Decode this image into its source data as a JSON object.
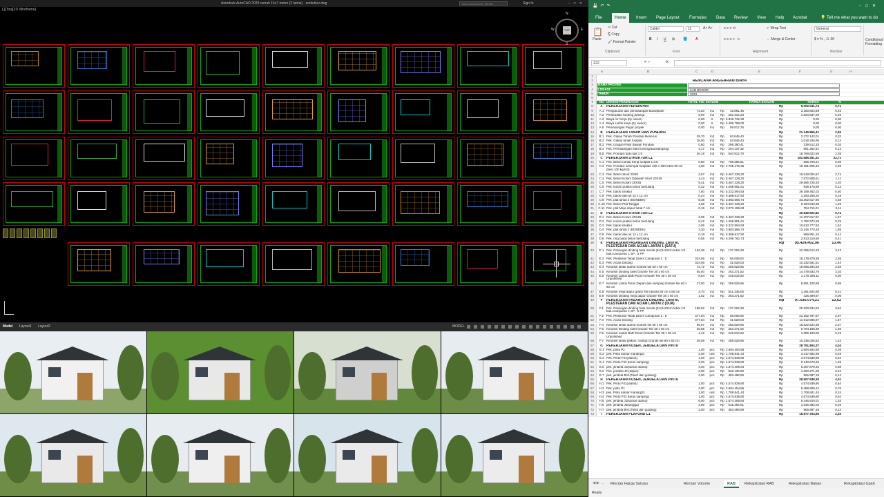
{
  "autocad": {
    "view_label": "[-][Top][2D Wireframe]",
    "app_title": "Autodesk AutoCAD 2020   rumah 15x7 meter (2 lantai) - arsitektur.dwg",
    "search_placeholder": "Type a keyword or phrase",
    "user_label": "Sign In",
    "viewcube": {
      "top": "TOP",
      "n": "N",
      "s": "S",
      "w": "W",
      "e": "E"
    },
    "layout_tabs": [
      "Model",
      "Layout1",
      "Layout2"
    ],
    "active_tab": "Model",
    "model_button": "MODEL",
    "colors": {
      "sheet_border": "#c00000",
      "sheet_frame": "#00b000",
      "background": "#000000"
    }
  },
  "excel": {
    "ribbon_tabs": [
      "File",
      "Home",
      "Insert",
      "Page Layout",
      "Formulas",
      "Data",
      "Review",
      "View",
      "Help",
      "Acrobat"
    ],
    "active_tab": "Home",
    "tell_me": "Tell me what you want to do",
    "clipboard": {
      "paste": "Paste",
      "cut": "Cut",
      "copy": "Copy",
      "format_painter": "Format Painter",
      "group": "Clipboard"
    },
    "font": {
      "name": "Calibri",
      "size": "11",
      "group": "Font"
    },
    "alignment": {
      "wrap_text": "Wrap Text",
      "merge_center": "Merge & Center",
      "group": "Alignment"
    },
    "number": {
      "format": "General",
      "group": "Number"
    },
    "conditional": "Conditional Formatting",
    "name_box": "Z22",
    "fx": "fx",
    "columns": [
      "A",
      "B",
      "C",
      "D",
      "E",
      "F",
      "G",
      "H"
    ],
    "sheet_title": "RENCANA ANGGARAN BIAYA",
    "info": [
      {
        "label": "NAMA PROYEK",
        "value": ""
      },
      {
        "label": "LOKASI",
        "value": "KAB BOGOR"
      },
      {
        "label": "TAHUN",
        "value": "2023"
      }
    ],
    "header": {
      "no": "NO",
      "uraian": "URAIAN PEKERJAAN",
      "vol": "TOTAL VOLUM",
      "sat": "SATUAN",
      "hs": "HARGA SATUAN",
      "hg": "HARGA",
      "pc": "%"
    },
    "rows": [
      {
        "n": "8",
        "no": "A",
        "u": "PEKERJAAN PERSIAPAN",
        "rp2": "Rp",
        "hg": "5.002.041,74",
        "pc": "0,71",
        "sec": true
      },
      {
        "n": "9",
        "no": "A.1",
        "u": "Pengukuran dan pemasangan Bouwplank",
        "v": "74,20",
        "s": "m1",
        "rp1": "Rp",
        "hs": "42.861,46",
        "rp2": "Rp",
        "hg": "3.180.804,89",
        "pc": "0,45"
      },
      {
        "n": "10",
        "no": "A.2",
        "u": "Pembuatan bedeng pekerja",
        "v": "9,00",
        "s": "m2",
        "rp1": "Rp",
        "hs": "202.315,23",
        "rp2": "Rp",
        "hg": "1.820.837,09",
        "pc": "0,26"
      },
      {
        "n": "11",
        "no": "A.3",
        "u": "Biaya Air Kerja (by owner)",
        "v": "0,00",
        "s": "ls",
        "rp1": "Rp",
        "hs": "6.849.732,30",
        "rp2": "Rp",
        "hg": "0,00",
        "pc": "0,00"
      },
      {
        "n": "12",
        "no": "A.4",
        "u": "Biaya Listrik kerja (by owner)",
        "v": "0,00",
        "s": "ls",
        "rp1": "Rp",
        "hs": "3.496.788,00",
        "rp2": "Rp",
        "hg": "0,00",
        "pc": "0,00"
      },
      {
        "n": "13",
        "no": "A.5",
        "u": "Pemasangan Pagar proyek",
        "v": "0,00",
        "s": "m1",
        "rp1": "Rp",
        "hs": "59.512,76",
        "rp2": "Rp",
        "hg": "0,00",
        "pc": "0,00"
      },
      {
        "n": "14",
        "no": "B",
        "u": "PEKERJAAN TANAH DAN PONDASI",
        "rp2": "Rp",
        "hg": "21.149.856,41",
        "pc": "2,96",
        "sec": true
      },
      {
        "n": "15",
        "no": "B.1",
        "u": "Pek. Galian Tanah Pondasi Menerus",
        "v": "35,70",
        "s": "m3",
        "rp1": "Rp",
        "hs": "63.645,43",
        "rp2": "Rp",
        "hg": "2.272.142,01",
        "pc": "0,32"
      },
      {
        "n": "16",
        "no": "B.2",
        "u": "Pek. Galian tanah footplat",
        "v": "16,00",
        "s": "m3",
        "rp1": "Rp",
        "hs": "63.645,43",
        "rp2": "Rp",
        "hg": "1.018.326,95",
        "pc": "0,14"
      },
      {
        "n": "17",
        "no": "B.3",
        "u": "Pek. Urugan Pasir Bawah Pondasi",
        "v": "0,80",
        "s": "m3",
        "rp1": "Rp",
        "hs": "299.390,41",
        "rp2": "Rp",
        "hg": "239.512,33",
        "pc": "0,03"
      },
      {
        "n": "18",
        "no": "B.4",
        "u": "Pek. Pemasangan batu kosong/aanstampingl",
        "v": "4,17",
        "s": "m3",
        "rp1": "Rp",
        "hs": "204.137,32",
        "rp2": "Rp",
        "hg": "851.252,61",
        "pc": "0,12"
      },
      {
        "n": "19",
        "no": "B.5",
        "u": "Pek. Pondasi batu kali 1:5",
        "v": "26,18",
        "s": "m3",
        "rp1": "Rp",
        "hs": "640.912,70",
        "rp2": "Rp",
        "hg": "16.768.622,50",
        "pc": "2,35"
      },
      {
        "n": "20",
        "no": "C",
        "u": "PEKERJAAN STRUKTUR L1",
        "rp2": "Rp",
        "hg": "161.685.351,31",
        "pc": "22,71",
        "sec": true
      },
      {
        "n": "21",
        "no": "C.1",
        "u": "Pek. Beton Lantai Kerja footplat 1:3:5",
        "v": "0,80",
        "s": "m3",
        "rp1": "Rp",
        "hs": "708.386,51",
        "rp2": "Rp",
        "hg": "566.709,21",
        "pc": "0,08"
      },
      {
        "n": "22",
        "no": "C.2",
        "u": "Pek. Pondasi setempat footplate 100 x 100 tebal 30 cm (besi 100 kg/m3)",
        "v": "4,00",
        "s": "m3",
        "rp1": "Rp",
        "hs": "4.795.476,36",
        "rp2": "Rp",
        "hg": "19.181.905,43",
        "pc": "2,69",
        "tall": true
      },
      {
        "n": "23",
        "no": "C.3",
        "u": "Pek. Beton Sloof 20/30",
        "v": "3,57",
        "s": "m3",
        "rp1": "Rp",
        "hs": "5.467.228,20",
        "rp2": "Rp",
        "hg": "19.518.004,67",
        "pc": "2,74"
      },
      {
        "n": "24",
        "no": "C.4",
        "u": "Pek. Beton Kolom Dibawah Sloof 20X45",
        "v": "1,44",
        "s": "m3",
        "rp1": "Rp",
        "hs": "5.467.228,20",
        "rp2": "Rp",
        "hg": "7.872.808,61",
        "pc": "1,11"
      },
      {
        "n": "25",
        "no": "C.5",
        "u": "Pek. Beton Kolom 20X45",
        "v": "5,41",
        "s": "m3",
        "rp1": "Rp",
        "hs": "5.467.228,20",
        "rp2": "Rp",
        "hg": "29.565.728,25",
        "pc": "4,20"
      },
      {
        "n": "26",
        "no": "C.6",
        "u": "Pek. kolom praktis beton bertulang",
        "v": "0,22",
        "s": "m3",
        "rp1": "Rp",
        "hs": "4.268.981,61",
        "rp2": "Rp",
        "hg": "939.175,95",
        "pc": "0,13"
      },
      {
        "n": "27",
        "no": "C.7",
        "u": "Pek. balok struktur",
        "v": "7,50",
        "s": "m3",
        "rp1": "Rp",
        "hs": "5.222.594,93",
        "rp2": "Rp",
        "hg": "39.169.462,02",
        "pc": "5,50"
      },
      {
        "n": "28",
        "no": "C.8",
        "u": "Pek. balok latei uk 12 x 12 cm",
        "v": "0,24",
        "s": "m3",
        "rp1": "Rp",
        "hs": "5.388.617,50",
        "rp2": "Rp",
        "hg": "1.293.268,20",
        "pc": "0,18"
      },
      {
        "n": "29",
        "no": "C.9",
        "u": "Pek. plat lantai 2 (BONDEK)",
        "v": "8,36",
        "s": "m3",
        "rp1": "Rp",
        "hs": "3.983.566,74",
        "rp2": "Rp",
        "hg": "33.302.617,96",
        "pc": "4,68"
      },
      {
        "n": "30",
        "no": "C.10",
        "u": "Pek. Beton Plat Tangga",
        "v": "1,68",
        "s": "m3",
        "rp1": "Rp",
        "hs": "5.467.228,20",
        "rp2": "Rp",
        "hg": "9.184.943,38",
        "pc": "1,29"
      },
      {
        "n": "31",
        "no": "C.11",
        "u": "Pek. plat Meja dapur tebal 7 cm",
        "v": "0,19",
        "s": "m3",
        "rp1": "Rp",
        "hs": "3.972.185,83",
        "rp2": "Rp",
        "hg": "754.715,21",
        "pc": "0,11"
      },
      {
        "n": "32",
        "no": "D",
        "u": "PEKERJAAN STRUKTUR L2",
        "rp2": "Rp",
        "hg": "40.849.502,82",
        "pc": "5,74",
        "sec": true
      },
      {
        "n": "33",
        "no": "D.1",
        "u": "Pek. Beton Kolom 20X45",
        "v": "2,05",
        "s": "m3",
        "rp1": "Rp",
        "hs": "5.467.228,20",
        "rp2": "Rp",
        "hg": "11.207.817,81",
        "pc": "1,57"
      },
      {
        "n": "34",
        "no": "D.2",
        "u": "Pek. kolom praktis beton bertulang",
        "v": "0,42",
        "s": "m3",
        "rp1": "Rp",
        "hs": "4.268.981,61",
        "rp2": "Rp",
        "hg": "1.792.972,28",
        "pc": "0,25"
      },
      {
        "n": "35",
        "no": "D.3",
        "u": "Pek. balok struktur",
        "v": "2,05",
        "s": "m3",
        "rp1": "Rp",
        "hs": "5.222.594,93",
        "rp2": "Rp",
        "hg": "10.610.777,63",
        "pc": "1,52"
      },
      {
        "n": "36",
        "no": "D.4",
        "u": "Pek. plat lantai 2 (BONDEK)",
        "v": "3,30",
        "s": "m3",
        "rp1": "Rp",
        "hs": "3.983.566,74",
        "rp2": "Rp",
        "hg": "13.145.770,25",
        "pc": "1,85"
      },
      {
        "n": "37",
        "no": "D.5",
        "u": "Pek. balok latei uk 12 x 12 cm",
        "v": "0,18",
        "s": "m3",
        "rp1": "Rp",
        "hs": "5.388.617,50",
        "rp2": "Rp",
        "hg": "969.951,15",
        "pc": "0,14"
      },
      {
        "n": "38",
        "no": "D.6",
        "u": "Pek. ring balok beton bertulang",
        "v": "0,55",
        "s": "m3",
        "rp1": "Rp",
        "hs": "5.296.762,73",
        "rp2": "Rp",
        "hg": "2.913.219,50",
        "pc": "0,41"
      },
      {
        "n": "39",
        "no": "E",
        "u": "PEKERJAAN PASANGAN DINDING, LANTAI, PLESTERAN DAN ACIAN LANTAI 1 (SATU)",
        "rp2": "Rp",
        "hg": "95.424.402,96",
        "pc": "13,40",
        "sec": true,
        "tall": true,
        "big": true
      },
      {
        "n": "40",
        "no": "E.1",
        "u": "Pek. Pasangan dinding bata merah (5x11x22cm tebal 1/2 batu campuran 1 SP : 5 PP",
        "v": "162,28",
        "s": "m2",
        "rp1": "Rp",
        "hs": "137.204,29",
        "rp2": "Rp",
        "hg": "22.265.512,23",
        "pc": "3,13",
        "tall": true
      },
      {
        "n": "41",
        "no": "E.2",
        "u": "Pek. Plesteran Tebal 15mm Campuran 1 : 5",
        "v": "324,56",
        "s": "m2",
        "rp1": "Rp",
        "hs": "56.009,92",
        "rp2": "Rp",
        "hg": "18.178.579,38",
        "pc": "2,55"
      },
      {
        "n": "42",
        "no": "E.3",
        "u": "Pek. Acian Dinding",
        "v": "324,56",
        "s": "m2",
        "rp1": "Rp",
        "hs": "31.528,03",
        "rp2": "Rp",
        "hg": "10.232.561,51",
        "pc": "1,44"
      },
      {
        "n": "43",
        "no": "E.4",
        "u": "Keramik lantai utama Granite tile 60 x 60 cm",
        "v": "73,72",
        "s": "m2",
        "rp1": "Rp",
        "hs": "258.529,66",
        "rp2": "Rp",
        "hg": "19.058.294,83",
        "pc": "2,68"
      },
      {
        "n": "44",
        "no": "E.5",
        "u": "Keramik Dinding toilet Granite Tile 30 x 60 cm",
        "v": "55,00",
        "s": "m2",
        "rp1": "Rp",
        "hs": "263.271,52",
        "rp2": "Rp",
        "hg": "14.479.933,79",
        "pc": "2,03"
      },
      {
        "n": "45",
        "no": "E.6",
        "u": "Keramik Lantai Bath Room Granite Tile 30 x 30 cm Unpolished",
        "v": "8,84",
        "s": "m2",
        "rp1": "Rp",
        "hs": "245.519,92",
        "rp2": "Rp",
        "hg": "2.170.396,11",
        "pc": "0,30",
        "tall": true
      },
      {
        "n": "46",
        "no": "E.7",
        "u": "Keramik Lantai Teras Depan dan samping Granite tile 60 x 60 cm",
        "v": "27,00",
        "s": "m2",
        "rp1": "Rp",
        "hs": "258.529,66",
        "rp2": "Rp",
        "hg": "6.991.100,88",
        "pc": "0,98",
        "tall": true
      },
      {
        "n": "47",
        "no": "E.8",
        "u": "Keramik meja dapur granit Tile ukuran 60 cm x 60 cm",
        "v": "2,70",
        "s": "m2",
        "rp1": "Rp",
        "hs": "541.335,00",
        "rp2": "Rp",
        "hg": "1.461.604,50",
        "pc": "0,21"
      },
      {
        "n": "48",
        "no": "E.9",
        "u": "Keramik Dinding meja dapur Granite Tile 30 x 60 cm",
        "v": "1,62",
        "s": "m2",
        "rp1": "Rp",
        "hs": "263.271,52",
        "rp2": "Rp",
        "hg": "426.499,87",
        "pc": "0,06"
      },
      {
        "n": "49",
        "no": "F",
        "u": "PEKERJAAN PASANGAN DINDING, LANTAI, PLESTERAN DAN ACIAN LANTAI 2 (DUA)",
        "rp2": "Rp",
        "hg": "97.036.074,21",
        "pc": "13,62",
        "sec": true,
        "tall": true,
        "big": true
      },
      {
        "n": "50",
        "no": "F.1",
        "u": "Pek. Pasangan dinding bata merah (5x11x22cm tebal 1/2 batu campuran 1 SP : 5 PP",
        "v": "188,92",
        "s": "m2",
        "rp1": "Rp",
        "hs": "137.204,29",
        "rp2": "Rp",
        "hg": "25.920.634,52",
        "pc": "3,64",
        "tall": true
      },
      {
        "n": "51",
        "no": "F.2",
        "u": "Pek. Plesteran Tebal 15mm Campuran 1 : 5",
        "v": "377,84",
        "s": "m2",
        "rp1": "Rp",
        "hs": "56.009,92",
        "rp2": "Rp",
        "hg": "21.162.787,87",
        "pc": "2,97"
      },
      {
        "n": "52",
        "no": "F.3",
        "u": "Pek. Acian Dinding",
        "v": "377,84",
        "s": "m2",
        "rp1": "Rp",
        "hs": "31.528,03",
        "rp2": "Rp",
        "hg": "11.912.886,97",
        "pc": "1,67"
      },
      {
        "n": "53",
        "no": "F.4",
        "u": "Keramik lantai utama Granite tile 60 x 60 cm",
        "v": "65,07",
        "s": "m2",
        "rp1": "Rp",
        "hs": "258.529,66",
        "rp2": "Rp",
        "hg": "16.822.524,38",
        "pc": "2,37"
      },
      {
        "n": "54",
        "no": "F.5",
        "u": "Keramik Dinding toilet Granite Tile 30 x 60 cm",
        "v": "36,86",
        "s": "m2",
        "rp1": "Rp",
        "hs": "263.271,52",
        "rp2": "Rp",
        "hg": "9.704.188,36",
        "pc": "1,36"
      },
      {
        "n": "55",
        "no": "F.6",
        "u": "Keramik Lantai Bath Room Granite Tile 30 x 30 cm Unpolished",
        "v": "4,42",
        "s": "m2",
        "rp1": "Rp",
        "hs": "245.519,92",
        "rp2": "Rp",
        "hg": "1.085.198,05",
        "pc": "0,15",
        "tall": true
      },
      {
        "n": "56",
        "no": "F.7",
        "u": "Keramik lantai balkon, rooftop Granite tile 60 x 60 cm",
        "v": "39,59",
        "s": "m2",
        "rp1": "Rp",
        "hs": "258.529,66",
        "rp2": "Rp",
        "hg": "10.235.025,52",
        "pc": "1,44"
      },
      {
        "n": "57",
        "no": "G",
        "u": "PEKERJAAN KUSEN, JENDELA DAN PINTU",
        "rp2": "Rp",
        "hg": "28.791.804,37",
        "pc": "4,04",
        "sec": true
      },
      {
        "n": "58",
        "no": "G.1",
        "u": "Pek. pintu P1",
        "v": "1,00",
        "s": "pcs",
        "rp1": "Rp",
        "hs": "2.694.454,56",
        "rp2": "Rp",
        "hg": "2.694.454,56",
        "pc": "0,38"
      },
      {
        "n": "59",
        "no": "G.2",
        "u": "pek. Pintu kamar mandi(p2)",
        "v": "2,00",
        "s": "unit",
        "rp1": "Rp",
        "hs": "1.708.841,44",
        "rp2": "Rp",
        "hg": "3.417.682,89",
        "pc": "0,48"
      },
      {
        "n": "60",
        "no": "G.3",
        "u": "Pek. Pintu PJ1(utama)",
        "v": "1,00",
        "s": "pcs",
        "rp1": "Rp",
        "hs": "4.574.839,80",
        "rp2": "Rp",
        "hg": "4.574.839,80",
        "pc": "0,64"
      },
      {
        "n": "61",
        "no": "G.4",
        "u": "Pek. Pintu PJ2 (teras samping)",
        "v": "2,00",
        "s": "pcs",
        "rp1": "Rp",
        "hs": "4.574.839,80",
        "rp2": "Rp",
        "hg": "9.149.679,60",
        "pc": "1,28"
      },
      {
        "n": "62",
        "no": "G.5",
        "u": "pek. jendela J1(kamar utama)",
        "v": "4,00",
        "s": "pcs",
        "rp1": "Rp",
        "hs": "1.574.469,84",
        "rp2": "Rp",
        "hg": "6.297.879,34",
        "pc": "0,88"
      },
      {
        "n": "63",
        "no": "G.6",
        "u": "Pek. jendela J2 (dapur)",
        "v": "2,00",
        "s": "pcs",
        "rp1": "Rp",
        "hs": "845.135,50",
        "rp2": "Rp",
        "hg": "1.690.271,00",
        "pc": "0,24"
      },
      {
        "n": "64",
        "no": "G.7",
        "u": "pek. jendela BV1(Toilet dan gudang)",
        "v": "2,00",
        "s": "pcs",
        "rp1": "Rp",
        "hs": "483.498,59",
        "rp2": "Rp",
        "hg": "966.997,18",
        "pc": "0,14"
      },
      {
        "n": "65",
        "no": "H",
        "u": "PEKERJAAN KUSEN, JENDELA DAN PINTU",
        "rp2": "Rp",
        "hg": "28.507.638,30",
        "pc": "4,01",
        "sec": true
      },
      {
        "n": "66",
        "no": "H.1",
        "u": "Pek. Pintu PJ1(utama)",
        "v": "1,00",
        "s": "pcs",
        "rp1": "Rp",
        "hs": "4.574.839,80",
        "rp2": "Rp",
        "hg": "4.574.839,80",
        "pc": "0,64"
      },
      {
        "n": "67",
        "no": "H.2",
        "u": "Pek. pintu P1",
        "v": "2,00",
        "s": "pcs",
        "rp1": "Rp",
        "hs": "2.694.454,56",
        "rp2": "Rp",
        "hg": "5.388.909,12",
        "pc": "0,76"
      },
      {
        "n": "68",
        "no": "H.3",
        "u": "pek. Pintu kamar mandi(p2)",
        "v": "1,00",
        "s": "unit",
        "rp1": "Rp",
        "hs": "1.708.841,44",
        "rp2": "Rp",
        "hg": "1.708.841,44",
        "pc": "0,24"
      },
      {
        "n": "69",
        "no": "H.4",
        "u": "Pek. Pintu PJ2 (teras samping)",
        "v": "1,00",
        "s": "pcs",
        "rp1": "Rp",
        "hs": "4.574.839,80",
        "rp2": "Rp",
        "hg": "4.574.839,80",
        "pc": "0,64"
      },
      {
        "n": "70",
        "no": "H.5",
        "u": "pek. jendela J1(kamar utama)",
        "v": "6,00",
        "s": "pcs",
        "rp1": "Rp",
        "hs": "1.574.469,84",
        "rp2": "Rp",
        "hg": "9.446.819,01",
        "pc": "1,33"
      },
      {
        "n": "71",
        "no": "H.6",
        "u": "pek. jendela J3(tangga)",
        "v": "3,00",
        "s": "pcs",
        "rp1": "Rp",
        "hs": "615.464,01",
        "rp2": "Rp",
        "hg": "1.846.392,03",
        "pc": "0,26"
      },
      {
        "n": "72",
        "no": "H.7",
        "u": "pek. jendela BV1(Toilet dan gudang)",
        "v": "2,00",
        "s": "pcs",
        "rp1": "Rp",
        "hs": "483.498,59",
        "rp2": "Rp",
        "hg": "966.997,18",
        "pc": "0,14"
      },
      {
        "n": "73",
        "no": "I",
        "u": "PEKERJAAN PLAFOND L1",
        "rp2": "Rp",
        "hg": "16.577.754,96",
        "pc": "2,33",
        "sec": true
      }
    ],
    "sheet_tabs": [
      "Rincian Harga Satuan",
      "Rincian Volume",
      "RAB",
      "Rekapitulasi RAB",
      "Rekapitulasi Bahan",
      "Rekapitulasi Upah"
    ],
    "active_sheet": "RAB",
    "status": "Ready"
  }
}
